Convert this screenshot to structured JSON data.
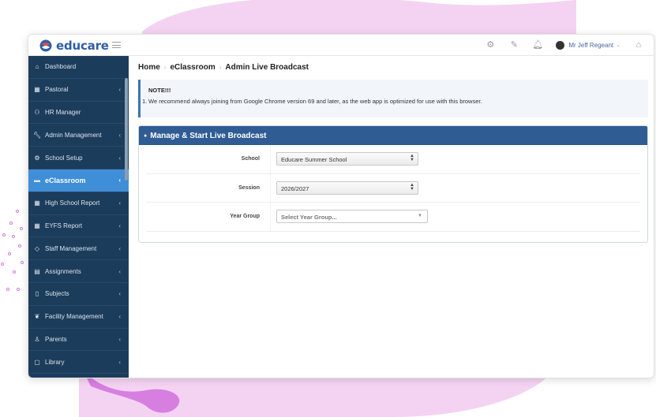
{
  "app": {
    "brand": "educare"
  },
  "topbar": {
    "icons": [
      "gear-icon",
      "edit-icon",
      "bell-icon",
      "home-icon"
    ],
    "user_name": "Mr Jeff Regeant"
  },
  "sidebar": {
    "items": [
      {
        "label": "Dashboard",
        "icon": "home-icon",
        "chevron": false,
        "active": false
      },
      {
        "label": "Pastoral",
        "icon": "table-icon",
        "chevron": true,
        "active": false
      },
      {
        "label": "HR Manager",
        "icon": "users-icon",
        "chevron": false,
        "active": false
      },
      {
        "label": "Admin Management",
        "icon": "wrench-icon",
        "chevron": true,
        "active": false
      },
      {
        "label": "School Setup",
        "icon": "gear-icon",
        "chevron": true,
        "active": false
      },
      {
        "label": "eClassroom",
        "icon": "folder-icon",
        "chevron": true,
        "active": true
      },
      {
        "label": "High School Report",
        "icon": "table-icon",
        "chevron": true,
        "active": false
      },
      {
        "label": "EYFS Report",
        "icon": "table-icon",
        "chevron": true,
        "active": false
      },
      {
        "label": "Staff Management",
        "icon": "diamond-icon",
        "chevron": true,
        "active": false
      },
      {
        "label": "Assignments",
        "icon": "book-icon",
        "chevron": true,
        "active": false
      },
      {
        "label": "Subjects",
        "icon": "notebook-icon",
        "chevron": true,
        "active": false
      },
      {
        "label": "Facility Management",
        "icon": "leaf-icon",
        "chevron": true,
        "active": false
      },
      {
        "label": "Parents",
        "icon": "user-icon",
        "chevron": true,
        "active": false
      },
      {
        "label": "Library",
        "icon": "book-open-icon",
        "chevron": true,
        "active": false
      }
    ]
  },
  "breadcrumb": {
    "home": "Home",
    "section": "eClassroom",
    "current": "Admin Live Broadcast"
  },
  "note": {
    "title": "NOTE!!!",
    "number": "1.",
    "text": "We recommend always joining from Google Chrome version 69 and later, as the web app is optimized for use with this browser."
  },
  "panel": {
    "title": "Manage & Start Live Broadcast",
    "school_label": "School",
    "school_value": "Educare Summer School",
    "session_label": "Session",
    "session_value": "2026/2027",
    "year_group_label": "Year Group",
    "year_group_placeholder": "Select Year Group..."
  },
  "colors": {
    "sidebar_bg": "#1c3c5b",
    "active_item": "#3f8ed8",
    "panel_header": "#2f5c93",
    "brand_blue": "#2d5fa7",
    "blob_pink": "#f4d3f2",
    "blob_purple": "#d77fe0"
  }
}
